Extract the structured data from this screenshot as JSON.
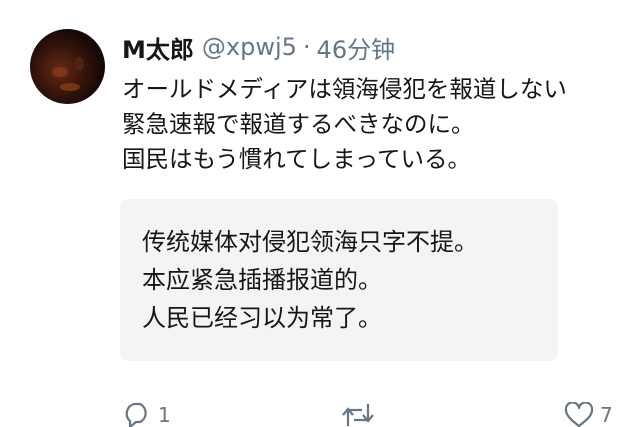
{
  "tweet": {
    "author_name": "M太郎",
    "handle": "@xpwj5",
    "separator": "·",
    "time": "46分钟",
    "text_lines": [
      "オールドメディアは領海侵犯を報道しない",
      "緊急速報で報道するべきなのに。",
      "国民はもう慣れてしまっている。"
    ],
    "quote_lines": [
      "传统媒体对侵犯领海只字不提。",
      "本应紧急插播报道的。",
      "人民已经习以为常了。"
    ]
  },
  "actions": {
    "reply_icon": "reply-icon",
    "reply_count": "1",
    "retweet_icon": "retweet-icon",
    "like_icon": "heart-icon",
    "like_count": "7"
  }
}
